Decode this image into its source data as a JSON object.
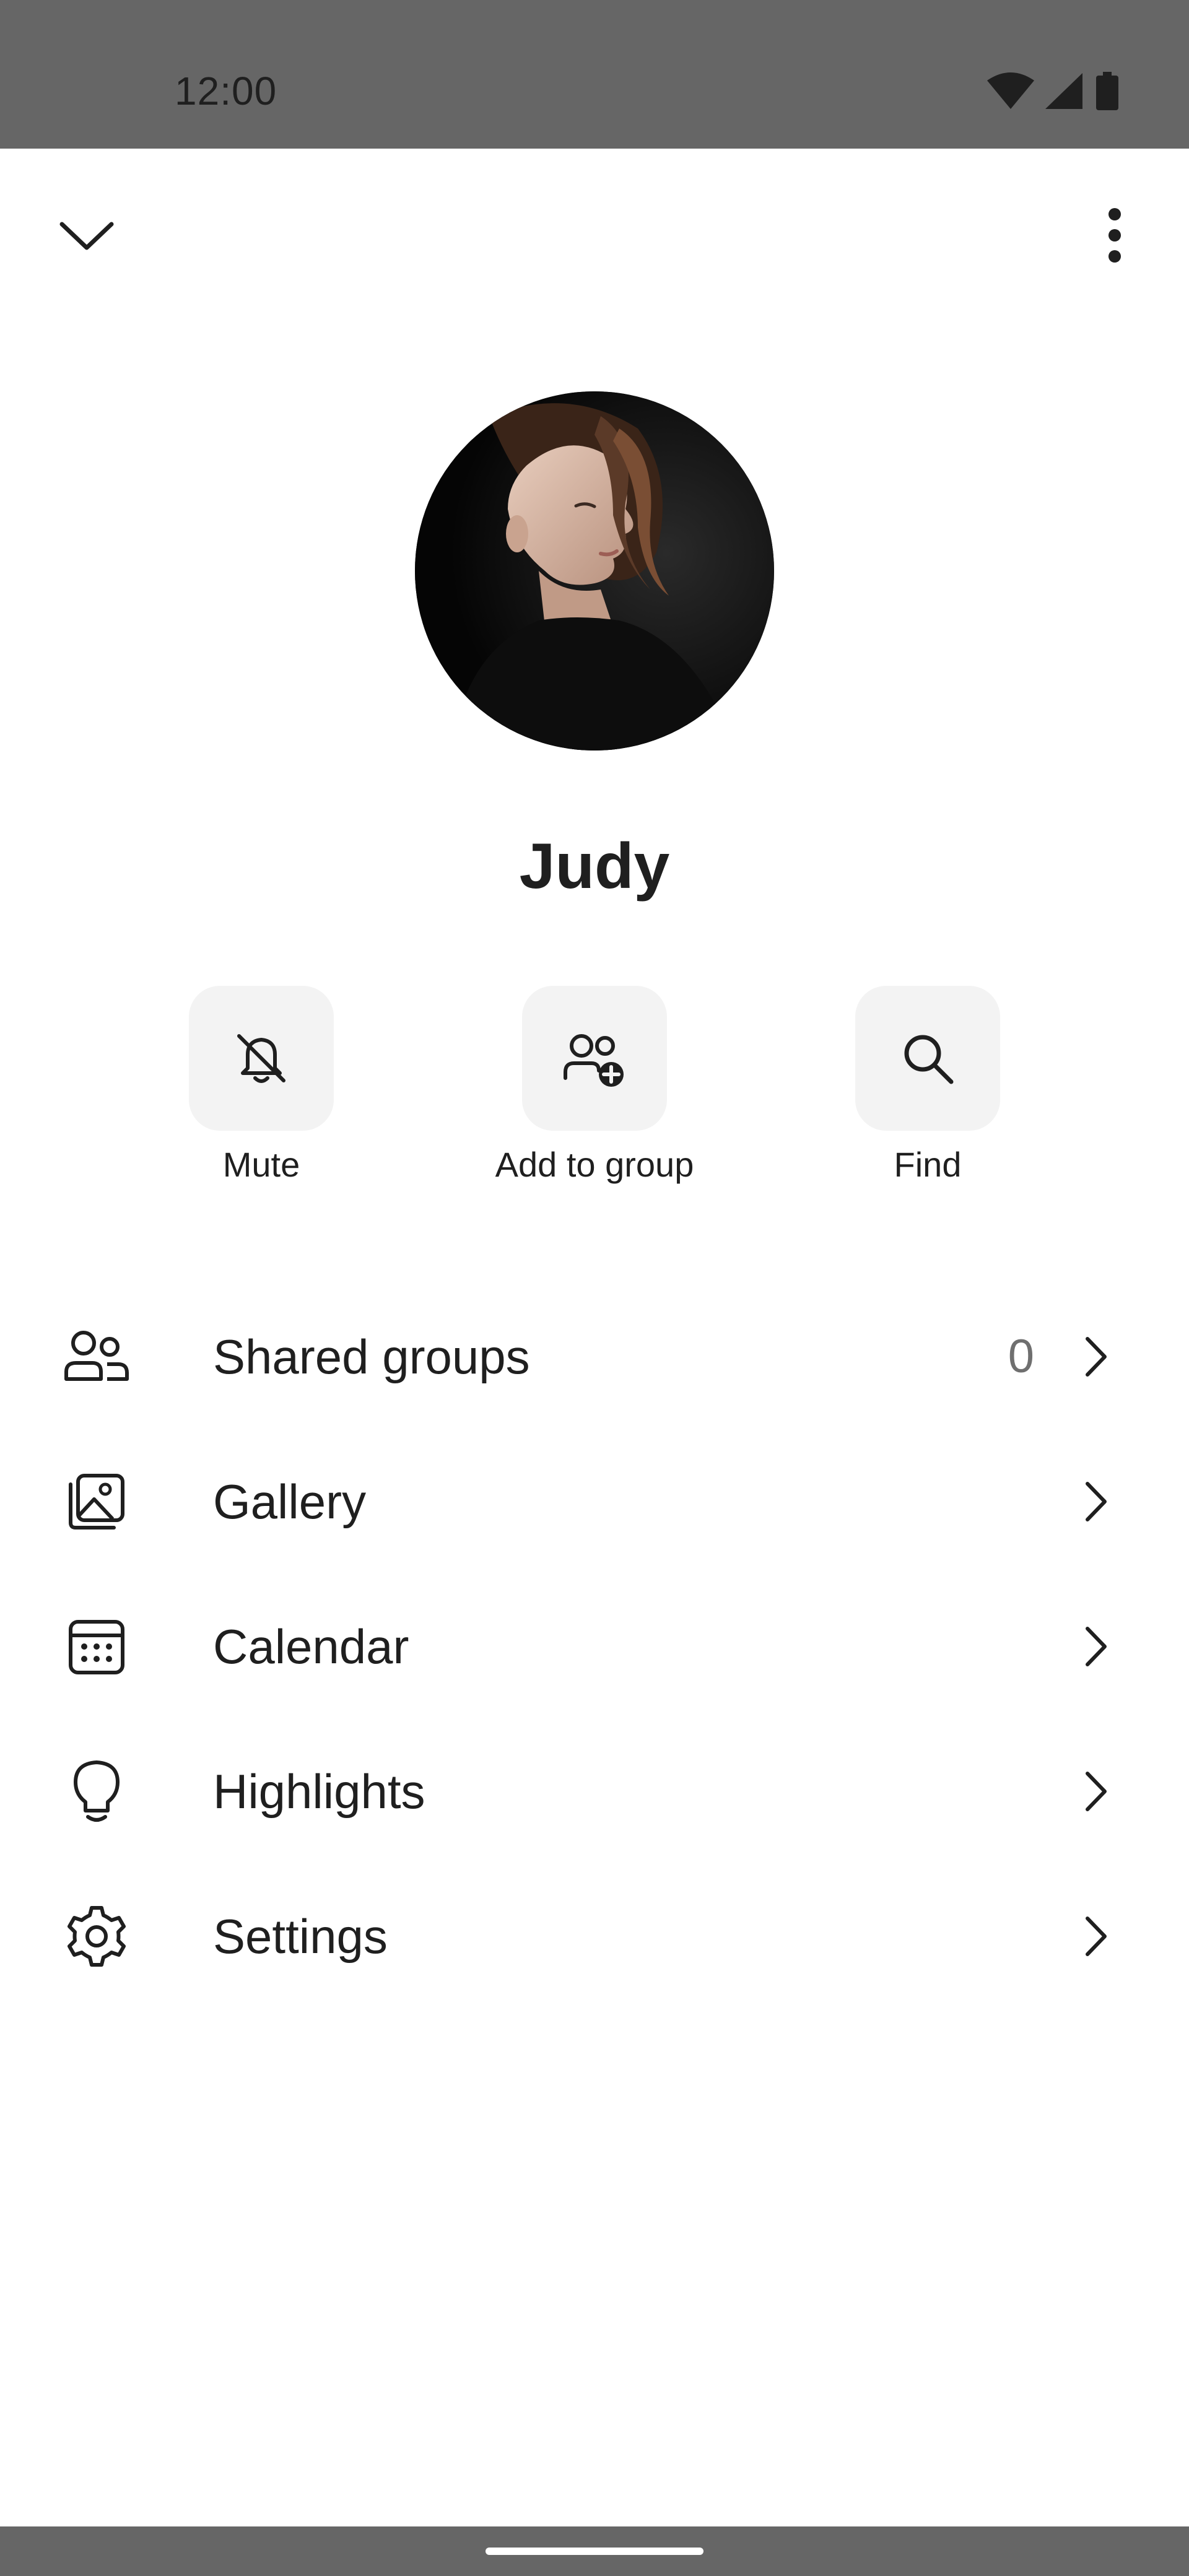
{
  "status_bar": {
    "time": "12:00"
  },
  "top_bar": {
    "back_icon": "chevron-down-icon",
    "menu_icon": "more-vert-icon"
  },
  "profile": {
    "name": "Judy",
    "avatar_icon": "avatar-photo"
  },
  "actions": [
    {
      "label": "Mute",
      "icon": "bell-off-icon"
    },
    {
      "label": "Add to group",
      "icon": "group-add-icon"
    },
    {
      "label": "Find",
      "icon": "search-icon"
    }
  ],
  "menu": [
    {
      "label": "Shared groups",
      "count": "0",
      "icon": "users-icon"
    },
    {
      "label": "Gallery",
      "icon": "image-icon"
    },
    {
      "label": "Calendar",
      "icon": "calendar-icon"
    },
    {
      "label": "Highlights",
      "icon": "lightbulb-icon"
    },
    {
      "label": "Settings",
      "icon": "gear-icon"
    }
  ],
  "colors": {
    "status_bar_bg": "#666666",
    "action_bg": "#f3f3f3",
    "text": "#1f1f1f",
    "secondary_text": "#6f6f6f"
  }
}
